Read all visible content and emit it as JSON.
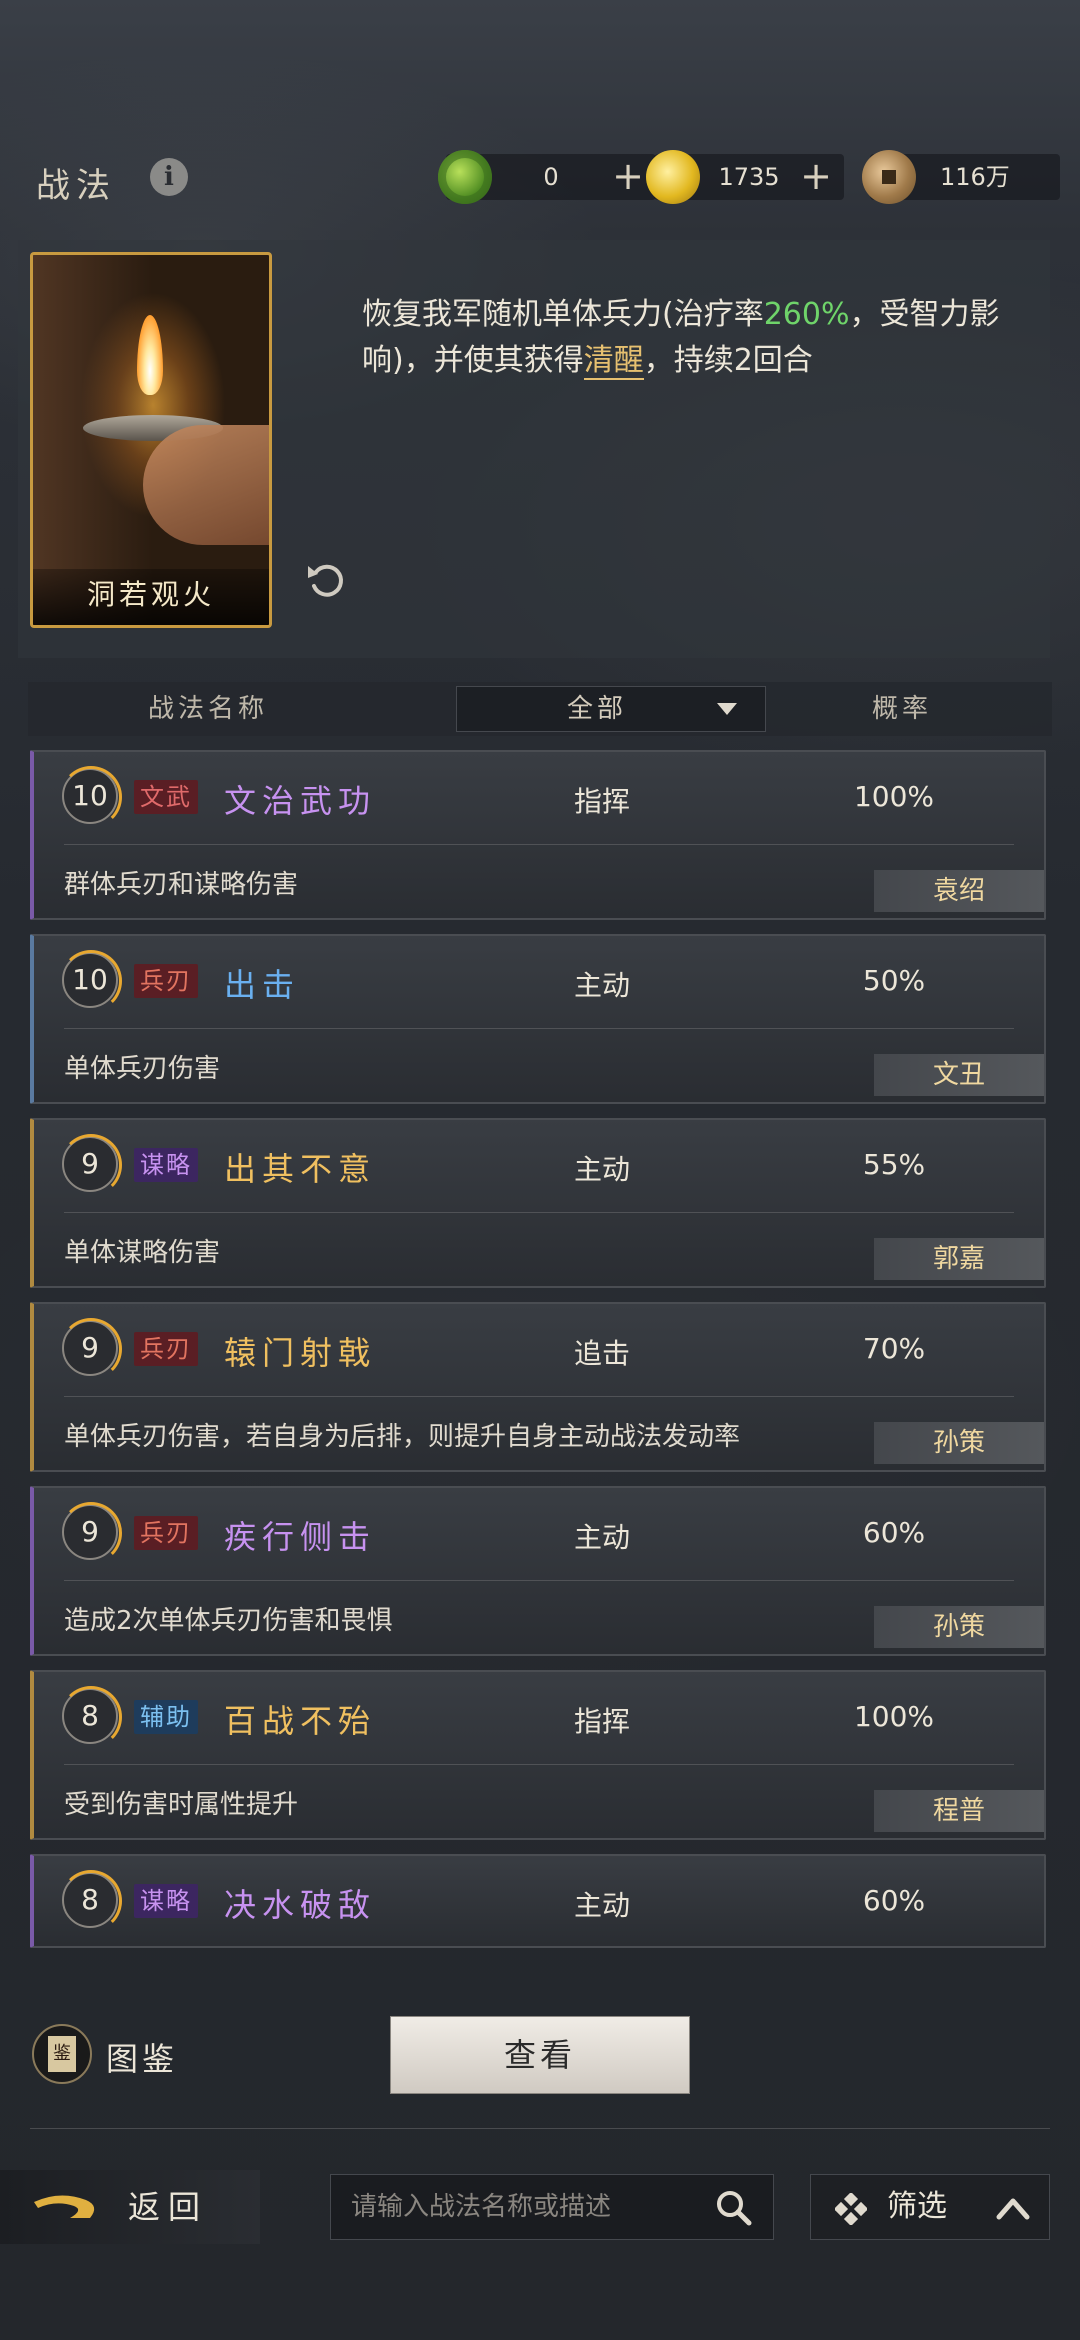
{
  "header": {
    "title": "战法",
    "currencies": [
      {
        "icon": "jade-coin-icon",
        "value": "0",
        "has_plus": true
      },
      {
        "icon": "gold-coin-icon",
        "value": "1735",
        "has_plus": true
      },
      {
        "icon": "copper-coin-icon",
        "value": "116万",
        "has_plus": false
      }
    ]
  },
  "skill": {
    "card_name": "洞若观火",
    "desc_part1": "恢复我军随机单体兵力(治疗率",
    "desc_rate": "260%",
    "desc_part2": "，受智力影响)，并使其获得",
    "desc_keyword": "清醒",
    "desc_part3": "，持续2回合"
  },
  "table": {
    "col_name": "战法名称",
    "filter_value": "全部",
    "col_rate": "概率"
  },
  "rows": [
    {
      "level": "10",
      "tag": "文武",
      "name": "文治武功",
      "type": "指挥",
      "rate": "100%",
      "desc": "群体兵刃和谋略伤害",
      "hero": "袁绍"
    },
    {
      "level": "10",
      "tag": "兵刃",
      "name": "出击",
      "type": "主动",
      "rate": "50%",
      "desc": "单体兵刃伤害",
      "hero": "文丑"
    },
    {
      "level": "9",
      "tag": "谋略",
      "name": "出其不意",
      "type": "主动",
      "rate": "55%",
      "desc": "单体谋略伤害",
      "hero": "郭嘉"
    },
    {
      "level": "9",
      "tag": "兵刃",
      "name": "辕门射戟",
      "type": "追击",
      "rate": "70%",
      "desc": "单体兵刃伤害，若自身为后排，则提升自身主动战法发动率",
      "hero": "孙策"
    },
    {
      "level": "9",
      "tag": "兵刃",
      "name": "疾行侧击",
      "type": "主动",
      "rate": "60%",
      "desc": "造成2次单体兵刃伤害和畏惧",
      "hero": "孙策"
    },
    {
      "level": "8",
      "tag": "辅助",
      "name": "百战不殆",
      "type": "指挥",
      "rate": "100%",
      "desc": "受到伤害时属性提升",
      "hero": "程普"
    },
    {
      "level": "8",
      "tag": "谋略",
      "name": "决水破敌",
      "type": "主动",
      "rate": "60%"
    }
  ],
  "bottom": {
    "tujian_label": "图鉴",
    "tujian_icon_char": "鉴",
    "view_button": "查看",
    "back_label": "返回",
    "search_placeholder": "请输入战法名称或描述",
    "filter_label": "筛选"
  },
  "colors": {
    "accent_gold": "#e6c070",
    "heal_green": "#6fd46a"
  }
}
